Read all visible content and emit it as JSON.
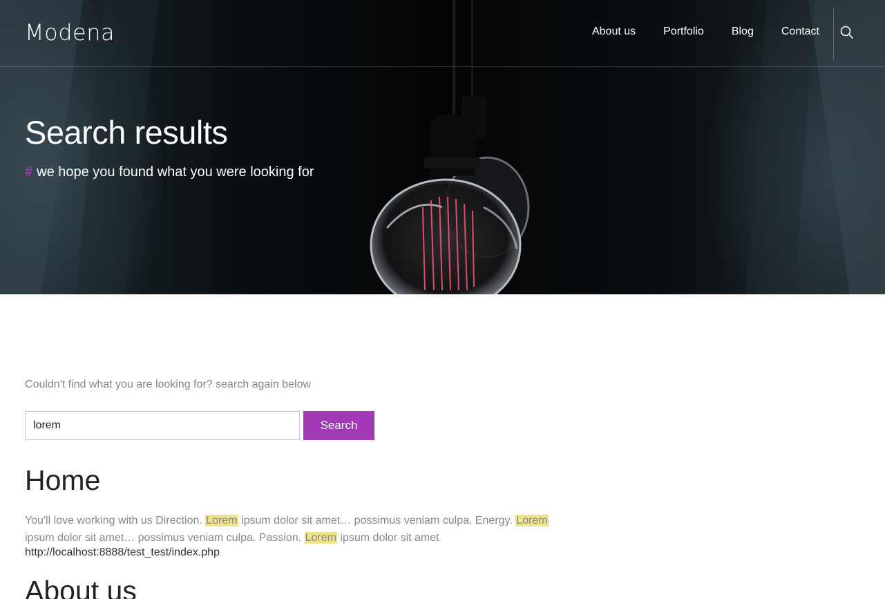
{
  "header": {
    "logo": "Modena",
    "nav": [
      {
        "label": "About us"
      },
      {
        "label": "Portfolio"
      },
      {
        "label": "Blog"
      },
      {
        "label": "Contact"
      }
    ],
    "search_icon": "search-icon"
  },
  "hero": {
    "title": "Search results",
    "hash": "#",
    "subtitle": "we hope you found what you were looking for"
  },
  "search": {
    "intro": "Couldn't find what you are looking for? search again below",
    "value": "lorem",
    "button_label": "Search"
  },
  "results": [
    {
      "title": "Home",
      "excerpt": [
        {
          "text": "You'll love working with us Direction. ",
          "highlight": false
        },
        {
          "text": "Lorem",
          "highlight": true
        },
        {
          "text": " ipsum dolor sit amet… possimus veniam culpa. Energy. ",
          "highlight": false
        },
        {
          "text": "Lorem",
          "highlight": true
        },
        {
          "text": " ipsum dolor sit amet… possimus veniam culpa. Passion. ",
          "highlight": false
        },
        {
          "text": "Lorem",
          "highlight": true
        },
        {
          "text": " ipsum dolor sit amet",
          "highlight": false
        }
      ],
      "url": "http://localhost:8888/test_test/index.php"
    },
    {
      "title": "About us"
    }
  ],
  "colors": {
    "accent": "#a23ab5",
    "highlight": "#efe38c"
  }
}
